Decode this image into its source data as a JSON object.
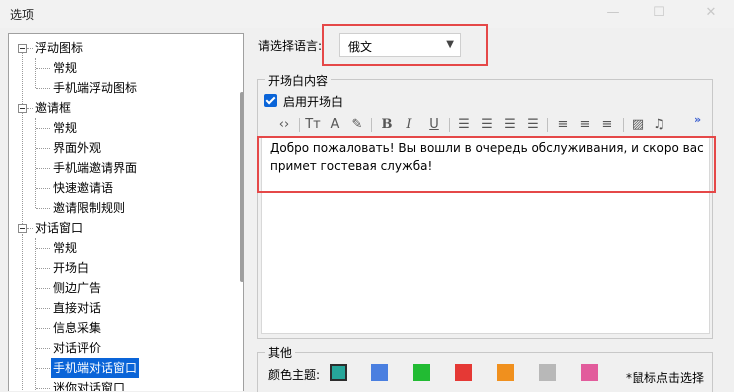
{
  "window": {
    "title": "选项"
  },
  "tree": {
    "items": [
      {
        "label": "浮动图标",
        "level": 0,
        "expanded": true,
        "selected": false
      },
      {
        "label": "常规",
        "level": 1,
        "selected": false
      },
      {
        "label": "手机端浮动图标",
        "level": 1,
        "selected": false
      },
      {
        "label": "邀请框",
        "level": 0,
        "expanded": true,
        "selected": false
      },
      {
        "label": "常规",
        "level": 1,
        "selected": false
      },
      {
        "label": "界面外观",
        "level": 1,
        "selected": false
      },
      {
        "label": "手机端邀请界面",
        "level": 1,
        "selected": false
      },
      {
        "label": "快速邀请语",
        "level": 1,
        "selected": false
      },
      {
        "label": "邀请限制规则",
        "level": 1,
        "selected": false
      },
      {
        "label": "对话窗口",
        "level": 0,
        "expanded": true,
        "selected": false
      },
      {
        "label": "常规",
        "level": 1,
        "selected": false
      },
      {
        "label": "开场白",
        "level": 1,
        "selected": false
      },
      {
        "label": "侧边广告",
        "level": 1,
        "selected": false
      },
      {
        "label": "直接对话",
        "level": 1,
        "selected": false
      },
      {
        "label": "信息采集",
        "level": 1,
        "selected": false
      },
      {
        "label": "对话评价",
        "level": 1,
        "selected": false
      },
      {
        "label": "手机端对话窗口",
        "level": 1,
        "selected": true
      },
      {
        "label": "迷你对话窗口",
        "level": 1,
        "selected": false
      }
    ]
  },
  "language": {
    "label": "请选择语言:",
    "value": "俄文"
  },
  "opening": {
    "group_title": "开场白内容",
    "enable_label": "启用开场白",
    "enabled": true,
    "toolbar_icons": [
      "code-view-icon",
      "clear-format-icon",
      "font-color-icon",
      "highlight-icon",
      "bold-icon",
      "italic-icon",
      "underline-icon",
      "ordered-list-icon",
      "unordered-list-icon",
      "outdent-icon",
      "indent-icon",
      "align-left-icon",
      "align-center-icon",
      "align-right-icon",
      "image-icon",
      "media-icon",
      "more-icon"
    ],
    "text": "Добро пожаловать! Вы вошли в очередь обслуживания, и скоро вас примет гостевая служба!"
  },
  "other": {
    "group_title": "其他",
    "color_label": "颜色主题:",
    "colors": [
      {
        "hex": "#26a69a",
        "selected": true
      },
      {
        "hex": "#4a7fe0",
        "selected": false
      },
      {
        "hex": "#22bb33",
        "selected": false
      },
      {
        "hex": "#e53935",
        "selected": false
      },
      {
        "hex": "#f0901e",
        "selected": false
      },
      {
        "hex": "#b8b8b8",
        "selected": false
      },
      {
        "hex": "#e25c9c",
        "selected": false
      }
    ],
    "hint": "*鼠标点击选择"
  }
}
